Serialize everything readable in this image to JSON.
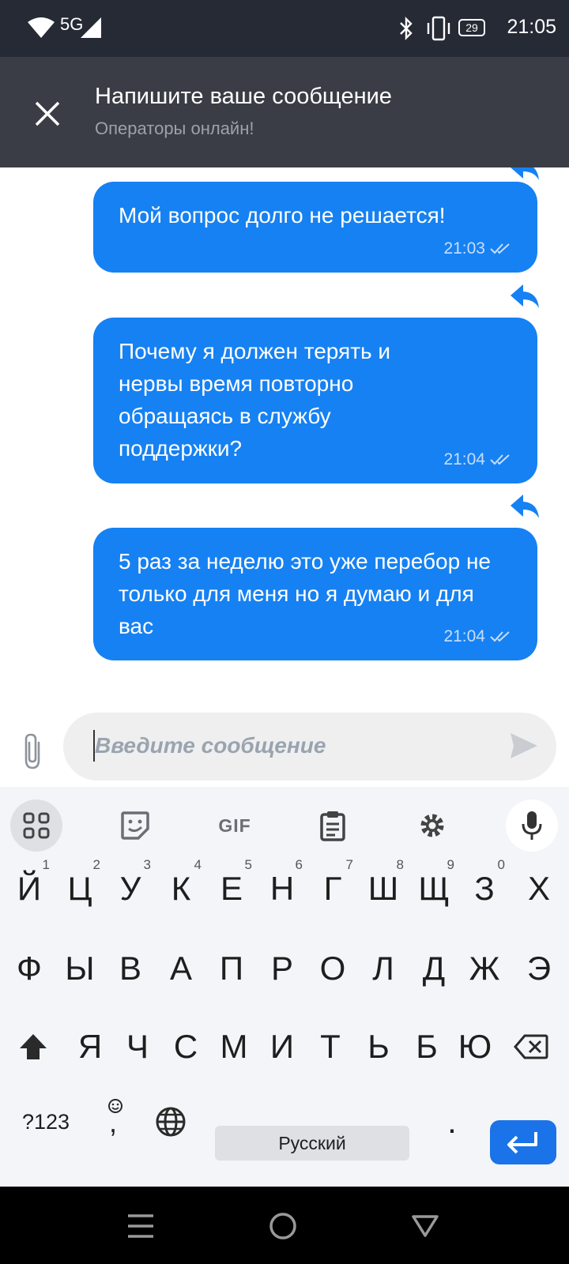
{
  "status_bar": {
    "network": "5G",
    "battery": "29",
    "time": "21:05"
  },
  "header": {
    "title": "Напишите ваше сообщение",
    "subtitle": "Операторы онлайн!"
  },
  "messages": [
    {
      "text": "Мой вопрос долго не решается!",
      "time": "21:03"
    },
    {
      "text": "Почему я должен терять и нервы время повторно обращаясь в службу поддержки?",
      "time": "21:04"
    },
    {
      "text": "5 раз за неделю это уже перебор не только для меня но я думаю и для вас",
      "time": "21:04"
    }
  ],
  "composer": {
    "placeholder": "Введите сообщение"
  },
  "keyboard": {
    "gif_label": "GIF",
    "row1": [
      "Й",
      "Ц",
      "У",
      "К",
      "Е",
      "Н",
      "Г",
      "Ш",
      "Щ",
      "З",
      "Х"
    ],
    "row1_nums": [
      "1",
      "2",
      "3",
      "4",
      "5",
      "6",
      "7",
      "8",
      "9",
      "0"
    ],
    "row2": [
      "Ф",
      "Ы",
      "В",
      "А",
      "П",
      "Р",
      "О",
      "Л",
      "Д",
      "Ж",
      "Э"
    ],
    "row3": [
      "Я",
      "Ч",
      "С",
      "М",
      "И",
      "Т",
      "Ь",
      "Б",
      "Ю"
    ],
    "symbols_label": "?123",
    "comma": ",",
    "space_label": "Русский",
    "period": "."
  },
  "colors": {
    "accent": "#1681f2",
    "header_bg": "#3a3d45",
    "status_bg": "#262a35"
  }
}
